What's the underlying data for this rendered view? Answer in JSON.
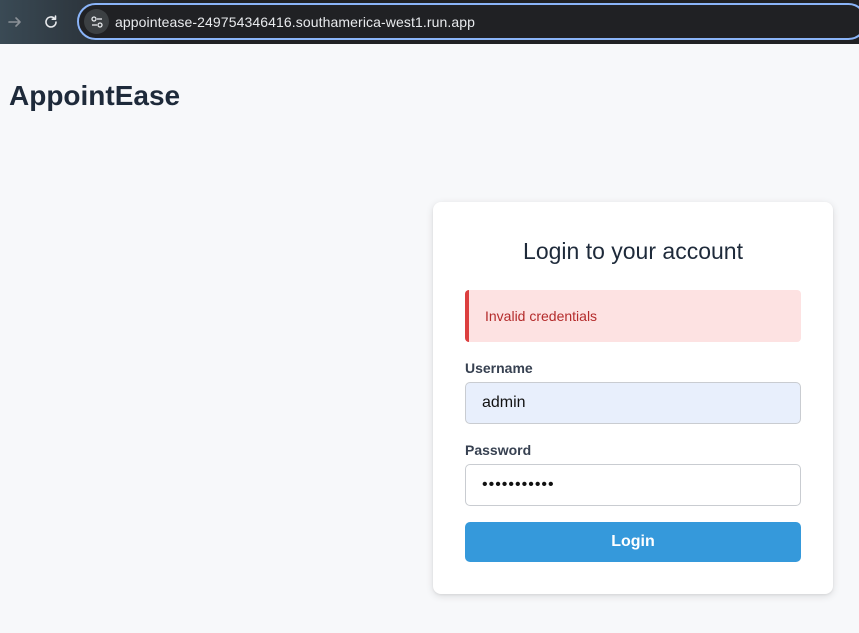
{
  "browser": {
    "url": "appointease-249754346416.southamerica-west1.run.app",
    "forward_icon": "arrow-right-icon",
    "reload_icon": "reload-icon",
    "site_info_icon": "tune-icon"
  },
  "app": {
    "title": "AppointEase"
  },
  "login": {
    "heading": "Login to your account",
    "error_message": "Invalid credentials",
    "username_label": "Username",
    "username_value": "admin",
    "password_label": "Password",
    "password_value": "•••••••••••",
    "submit_label": "Login"
  },
  "colors": {
    "accent": "#3599db",
    "error_bg": "#fde2e2",
    "error_border": "#dc3f3f",
    "error_text": "#b42b2b",
    "autofill_bg": "#e8effc"
  }
}
